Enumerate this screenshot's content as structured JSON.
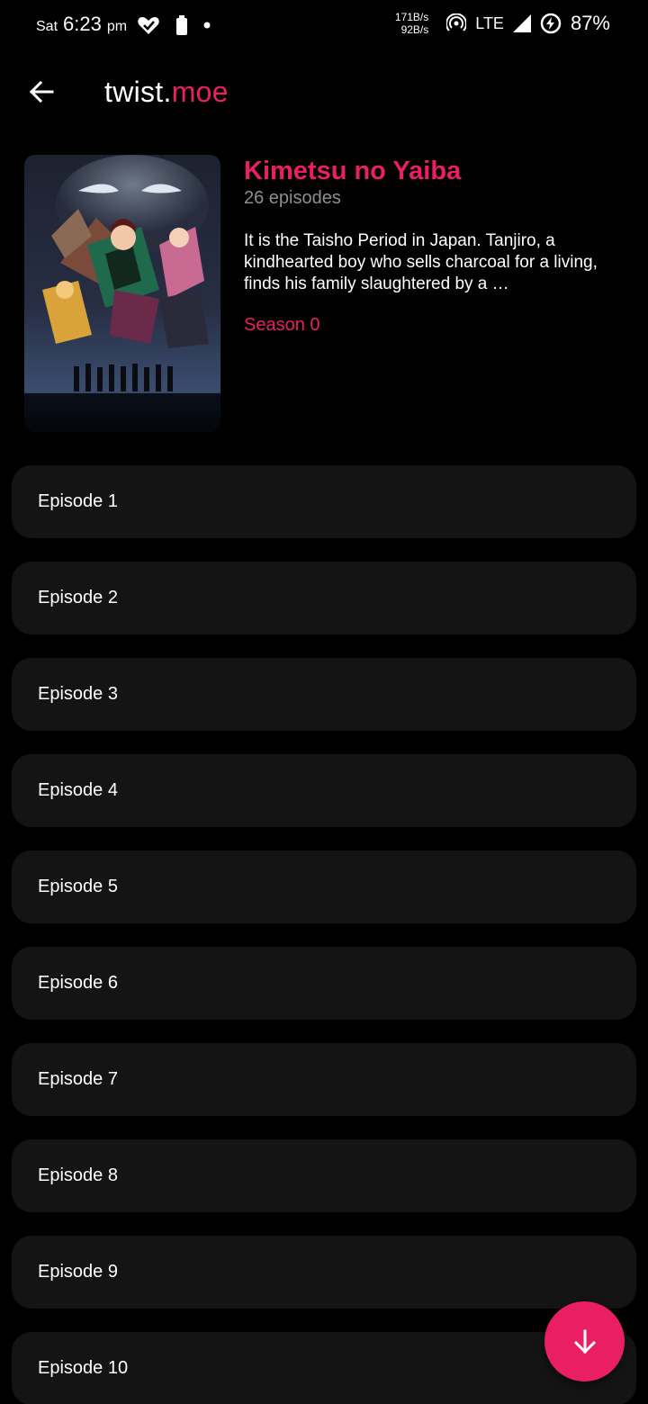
{
  "status_bar": {
    "day": "Sat",
    "time": "6:23",
    "ampm": "pm",
    "net_up": "171B/s",
    "net_down": "92B/s",
    "network": "LTE",
    "battery": "87%",
    "icons": [
      "heart-check-icon",
      "battery-saver-icon",
      "dot-icon",
      "hotspot-icon",
      "signal-icon",
      "battery-charging-icon"
    ]
  },
  "app_bar": {
    "title_main": "twist.",
    "title_accent": "moe",
    "back_icon": "back-arrow-icon"
  },
  "anime": {
    "title": "Kimetsu no Yaiba",
    "episodes_label": "26 episodes",
    "synopsis": "It is the Taisho Period in Japan. Tanjiro, a kindhearted boy who sells charcoal for a living, finds his family slaughtered by a …",
    "season": "Season 0"
  },
  "episodes": [
    "Episode 1",
    "Episode 2",
    "Episode 3",
    "Episode 4",
    "Episode 5",
    "Episode 6",
    "Episode 7",
    "Episode 8",
    "Episode 9",
    "Episode 10"
  ],
  "fab": {
    "icon": "arrow-down-icon"
  },
  "colors": {
    "accent": "#e91e63",
    "background": "#000000",
    "card": "#141414",
    "muted": "#8e8e8e"
  }
}
